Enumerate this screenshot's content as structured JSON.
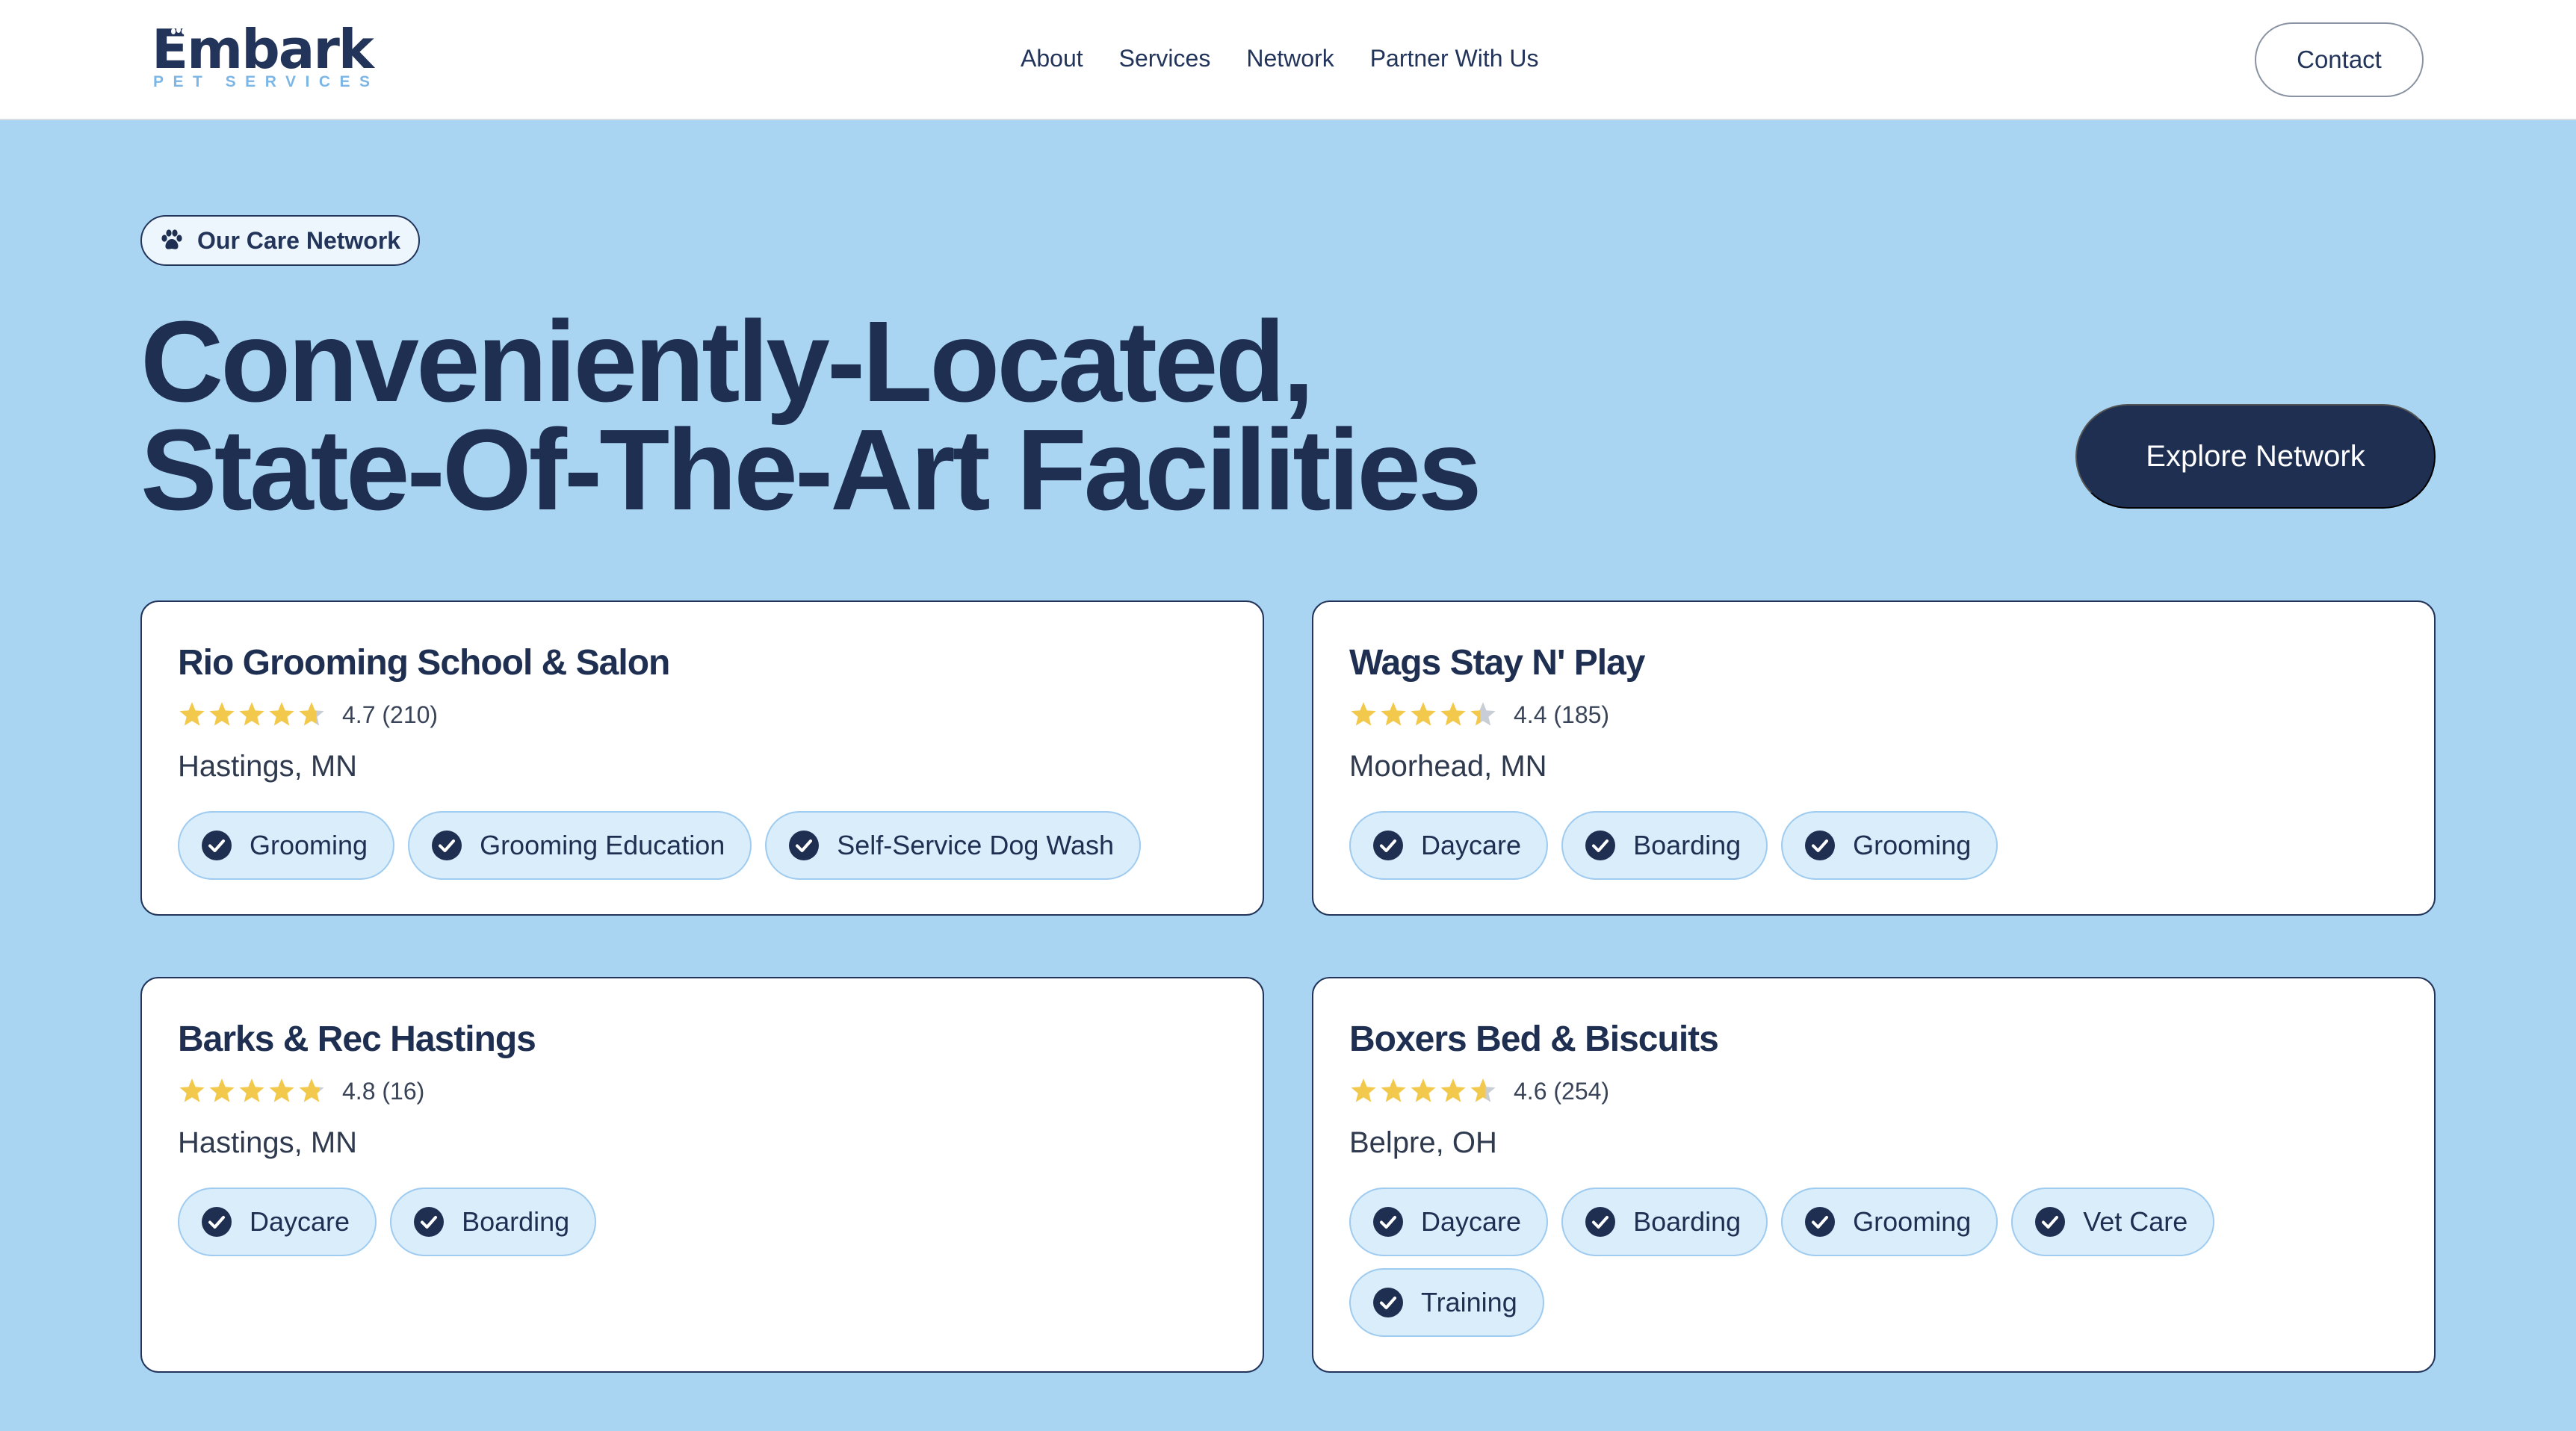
{
  "brand": {
    "name": "Embark",
    "tagline": "PET SERVICES",
    "colors": {
      "navy": "#1e2f52",
      "sky": "#a9d5f2",
      "star": "#f2c94c",
      "tag_bg": "#d9edfb"
    }
  },
  "nav": {
    "links": [
      {
        "label": "About"
      },
      {
        "label": "Services"
      },
      {
        "label": "Network"
      },
      {
        "label": "Partner With Us"
      }
    ],
    "contact_label": "Contact"
  },
  "hero": {
    "badge_icon": "paw-icon",
    "badge_label": "Our Care Network",
    "title_line1": "Conveniently-Located,",
    "title_line2": "State-Of-The-Art Facilities",
    "cta_label": "Explore Network"
  },
  "facilities": [
    {
      "name": "Rio Grooming School & Salon",
      "stars": 4.7,
      "rating": "4.7 (210)",
      "location": "Hastings, MN",
      "services": [
        "Grooming",
        "Grooming Education",
        "Self-Service Dog Wash"
      ]
    },
    {
      "name": "Wags Stay N' Play",
      "stars": 4.4,
      "rating": "4.4 (185)",
      "location": "Moorhead, MN",
      "services": [
        "Daycare",
        "Boarding",
        "Grooming"
      ]
    },
    {
      "name": "Barks & Rec Hastings",
      "stars": 4.8,
      "rating": "4.8 (16)",
      "location": "Hastings, MN",
      "services": [
        "Daycare",
        "Boarding"
      ]
    },
    {
      "name": "Boxers Bed & Biscuits",
      "stars": 4.6,
      "rating": "4.6 (254)",
      "location": "Belpre, OH",
      "services": [
        "Daycare",
        "Boarding",
        "Grooming",
        "Vet Care",
        "Training"
      ]
    }
  ]
}
